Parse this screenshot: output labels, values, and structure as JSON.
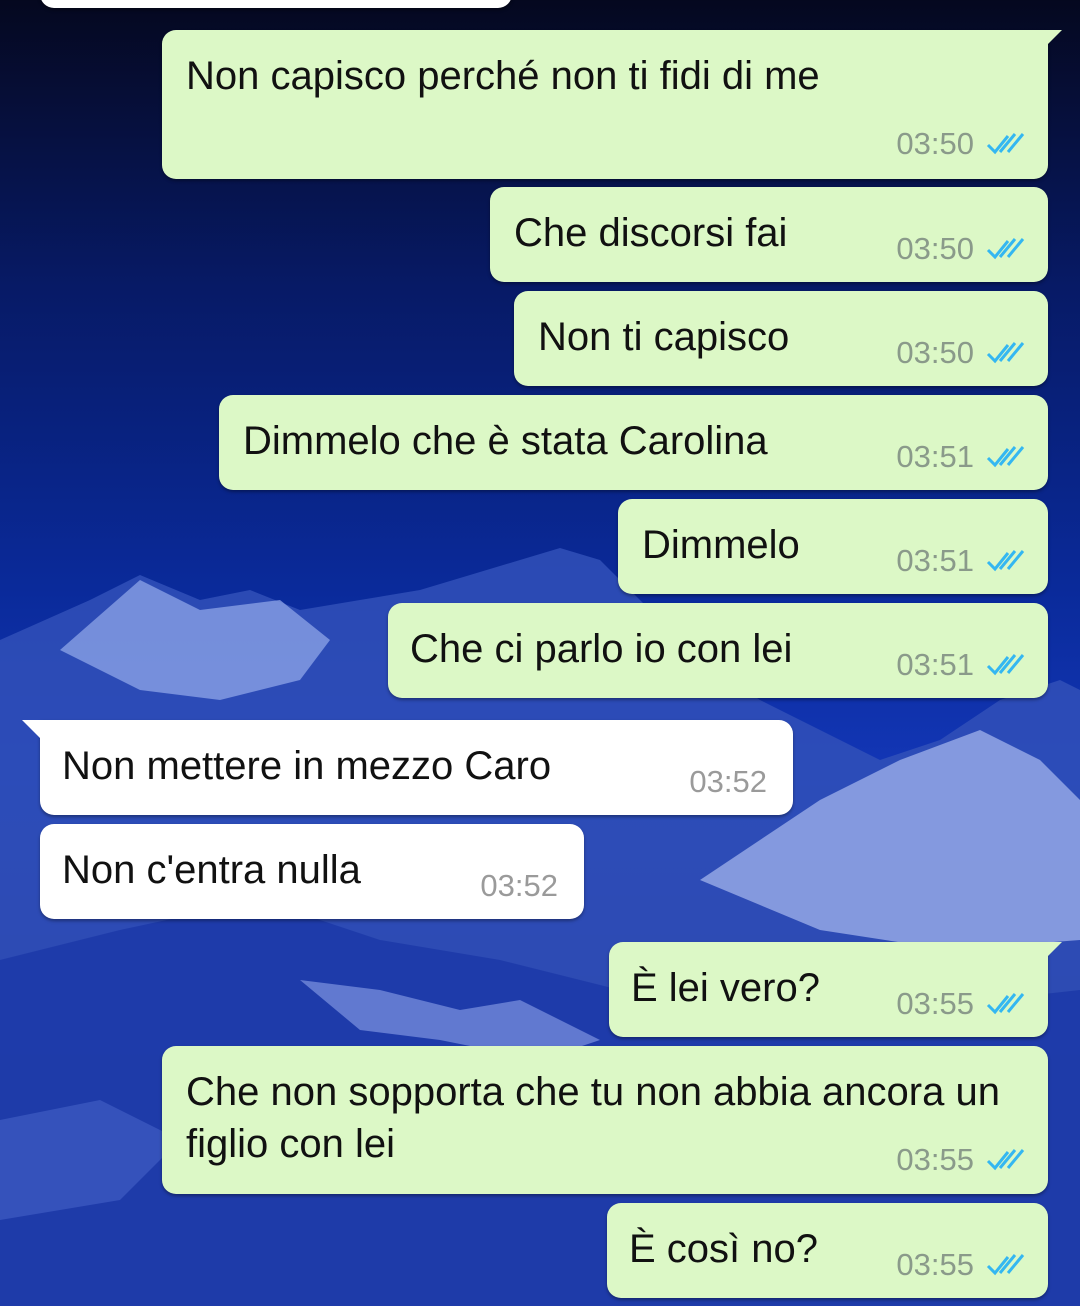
{
  "chat": {
    "messages": [
      {
        "direction": "out",
        "text": "Non capisco perché non ti fidi di me",
        "time": "03:50",
        "status_icon": "double-check-read-icon"
      },
      {
        "direction": "out",
        "text": "Che discorsi fai",
        "time": "03:50",
        "status_icon": "double-check-read-icon"
      },
      {
        "direction": "out",
        "text": "Non ti capisco",
        "time": "03:50",
        "status_icon": "double-check-read-icon"
      },
      {
        "direction": "out",
        "text": "Dimmelo che è stata Carolina",
        "time": "03:51",
        "status_icon": "double-check-read-icon"
      },
      {
        "direction": "out",
        "text": "Dimmelo",
        "time": "03:51",
        "status_icon": "double-check-read-icon"
      },
      {
        "direction": "out",
        "text": "Che ci parlo io con lei",
        "time": "03:51",
        "status_icon": "double-check-read-icon"
      },
      {
        "direction": "in",
        "text": "Non mettere in mezzo Caro",
        "time": "03:52"
      },
      {
        "direction": "in",
        "text": "Non c'entra nulla",
        "time": "03:52"
      },
      {
        "direction": "out",
        "text": "È lei vero?",
        "time": "03:55",
        "status_icon": "double-check-read-icon"
      },
      {
        "direction": "out",
        "text": "Che non sopporta che tu non abbia ancora un figlio con lei",
        "time": "03:55",
        "status_icon": "double-check-read-icon"
      },
      {
        "direction": "out",
        "text": "È così no?",
        "time": "03:55",
        "status_icon": "double-check-read-icon"
      }
    ]
  },
  "colors": {
    "outgoing_bubble": "#dcf8c6",
    "incoming_bubble": "#ffffff",
    "read_ticks": "#34b7f1"
  }
}
